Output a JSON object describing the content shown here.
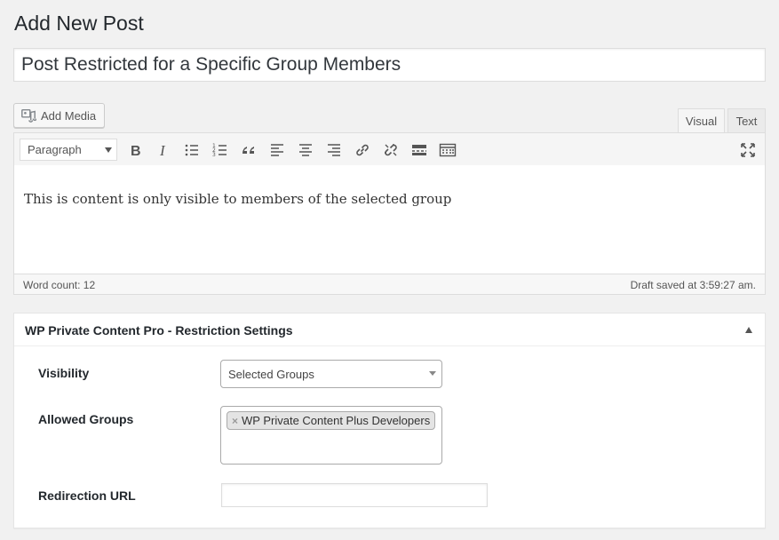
{
  "page": {
    "title": "Add New Post"
  },
  "post": {
    "title_value": "Post Restricted for a Specific Group Members"
  },
  "editor": {
    "add_media_label": "Add Media",
    "tabs": {
      "visual": "Visual",
      "text": "Text"
    },
    "format_select": "Paragraph",
    "toolbar_icons": [
      "bold-icon",
      "italic-icon",
      "bullet-list-icon",
      "numbered-list-icon",
      "blockquote-icon",
      "align-left-icon",
      "align-center-icon",
      "align-right-icon",
      "link-icon",
      "unlink-icon",
      "read-more-icon",
      "toolbar-toggle-icon",
      "fullscreen-icon"
    ],
    "content": "This is content is only visible to members of the selected group",
    "word_count": "Word count: 12",
    "draft_saved": "Draft saved at 3:59:27 am."
  },
  "metabox": {
    "title": "WP Private Content Pro - Restriction Settings",
    "fields": {
      "visibility_label": "Visibility",
      "visibility_value": "Selected Groups",
      "allowed_groups_label": "Allowed Groups",
      "allowed_groups": [
        "WP Private Content Plus Developers"
      ],
      "chip_remove": "×",
      "redirection_label": "Redirection URL",
      "redirection_value": ""
    }
  },
  "colors": {
    "background": "#f1f1f1",
    "panel": "#ffffff",
    "border": "#dddddd",
    "text": "#23282d"
  }
}
